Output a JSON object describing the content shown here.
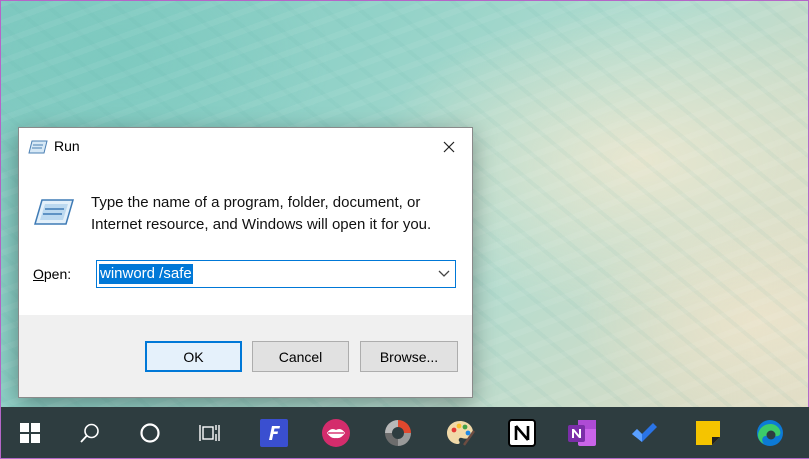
{
  "dialog": {
    "title": "Run",
    "description": "Type the name of a program, folder, document, or Internet resource, and Windows will open it for you.",
    "open_label_underlined": "O",
    "open_label_rest": "pen:",
    "open_value": "winword /safe",
    "ok_label": "OK",
    "cancel_label": "Cancel",
    "browse_label": "Browse..."
  },
  "taskbar": {
    "items": [
      {
        "icon": "windows-start-icon"
      },
      {
        "icon": "search-icon"
      },
      {
        "icon": "cortana-icon"
      },
      {
        "icon": "task-view-icon"
      },
      {
        "icon": "app-f-icon",
        "color": "#3a4fd0"
      },
      {
        "icon": "app-lips-icon",
        "color": "#d42c6c"
      },
      {
        "icon": "photoscape-icon"
      },
      {
        "icon": "paint-palette-icon"
      },
      {
        "icon": "notion-icon"
      },
      {
        "icon": "onenote-icon",
        "color": "#7b2ea8"
      },
      {
        "icon": "todo-check-icon",
        "color": "#2a74e6"
      },
      {
        "icon": "sticky-notes-icon",
        "color": "#f5c400"
      },
      {
        "icon": "edge-icon"
      }
    ]
  },
  "colors": {
    "accent": "#0078d7",
    "taskbar": "#2e3d40"
  }
}
